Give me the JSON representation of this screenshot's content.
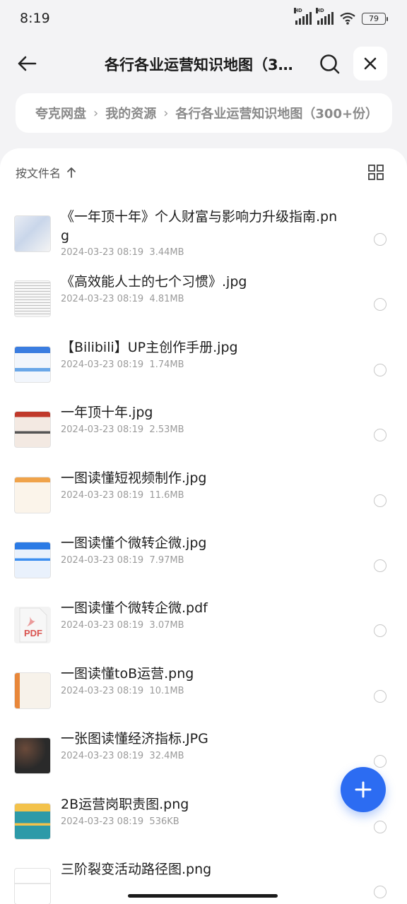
{
  "status_bar": {
    "time": "8:19",
    "hd1": "HD",
    "hd2": "HD",
    "battery": "79"
  },
  "header": {
    "title": "各行各业运营知识地图（300+份）",
    "back_icon": "arrow-left-icon",
    "search_icon": "search-icon",
    "close_icon": "close-icon"
  },
  "breadcrumb": {
    "items": [
      "夸克网盘",
      "我的资源",
      "各行各业运营知识地图（300+份）"
    ]
  },
  "sort": {
    "label": "按文件名",
    "arrow_icon": "arrow-up-icon",
    "view_icon": "grid-view-icon"
  },
  "files": [
    {
      "name_line1": "《一年顶十年》个人财富与影响力升级指南.pn",
      "name_line2": "g",
      "date": "2024-03-23 08:19",
      "size": "3.44MB",
      "thumb": "image"
    },
    {
      "name_line1": "《高效能人士的七个习惯》.jpg",
      "name_line2": "",
      "date": "2024-03-23 08:19",
      "size": "4.81MB",
      "thumb": "image"
    },
    {
      "name_line1": "【Bilibili】UP主创作手册.jpg",
      "name_line2": "",
      "date": "2024-03-23 08:19",
      "size": "1.74MB",
      "thumb": "image"
    },
    {
      "name_line1": "一年顶十年.jpg",
      "name_line2": "",
      "date": "2024-03-23 08:19",
      "size": "2.53MB",
      "thumb": "image"
    },
    {
      "name_line1": "一图读懂短视频制作.jpg",
      "name_line2": "",
      "date": "2024-03-23 08:19",
      "size": "11.6MB",
      "thumb": "image"
    },
    {
      "name_line1": "一图读懂个微转企微.jpg",
      "name_line2": "",
      "date": "2024-03-23 08:19",
      "size": "7.97MB",
      "thumb": "image"
    },
    {
      "name_line1": "一图读懂个微转企微.pdf",
      "name_line2": "",
      "date": "2024-03-23 08:19",
      "size": "3.07MB",
      "thumb": "pdf"
    },
    {
      "name_line1": "一图读懂toB运营.png",
      "name_line2": "",
      "date": "2024-03-23 08:19",
      "size": "10.1MB",
      "thumb": "image"
    },
    {
      "name_line1": "一张图读懂经济指标.JPG",
      "name_line2": "",
      "date": "2024-03-23 08:19",
      "size": "32.4MB",
      "thumb": "image"
    },
    {
      "name_line1": "2B运营岗职责图.png",
      "name_line2": "",
      "date": "2024-03-23 08:19",
      "size": "536KB",
      "thumb": "image"
    },
    {
      "name_line1": "三阶裂变活动路径图.png",
      "name_line2": "",
      "date": "",
      "size": "",
      "thumb": "image"
    }
  ],
  "pdf_label": "PDF",
  "fab_icon": "plus-icon"
}
